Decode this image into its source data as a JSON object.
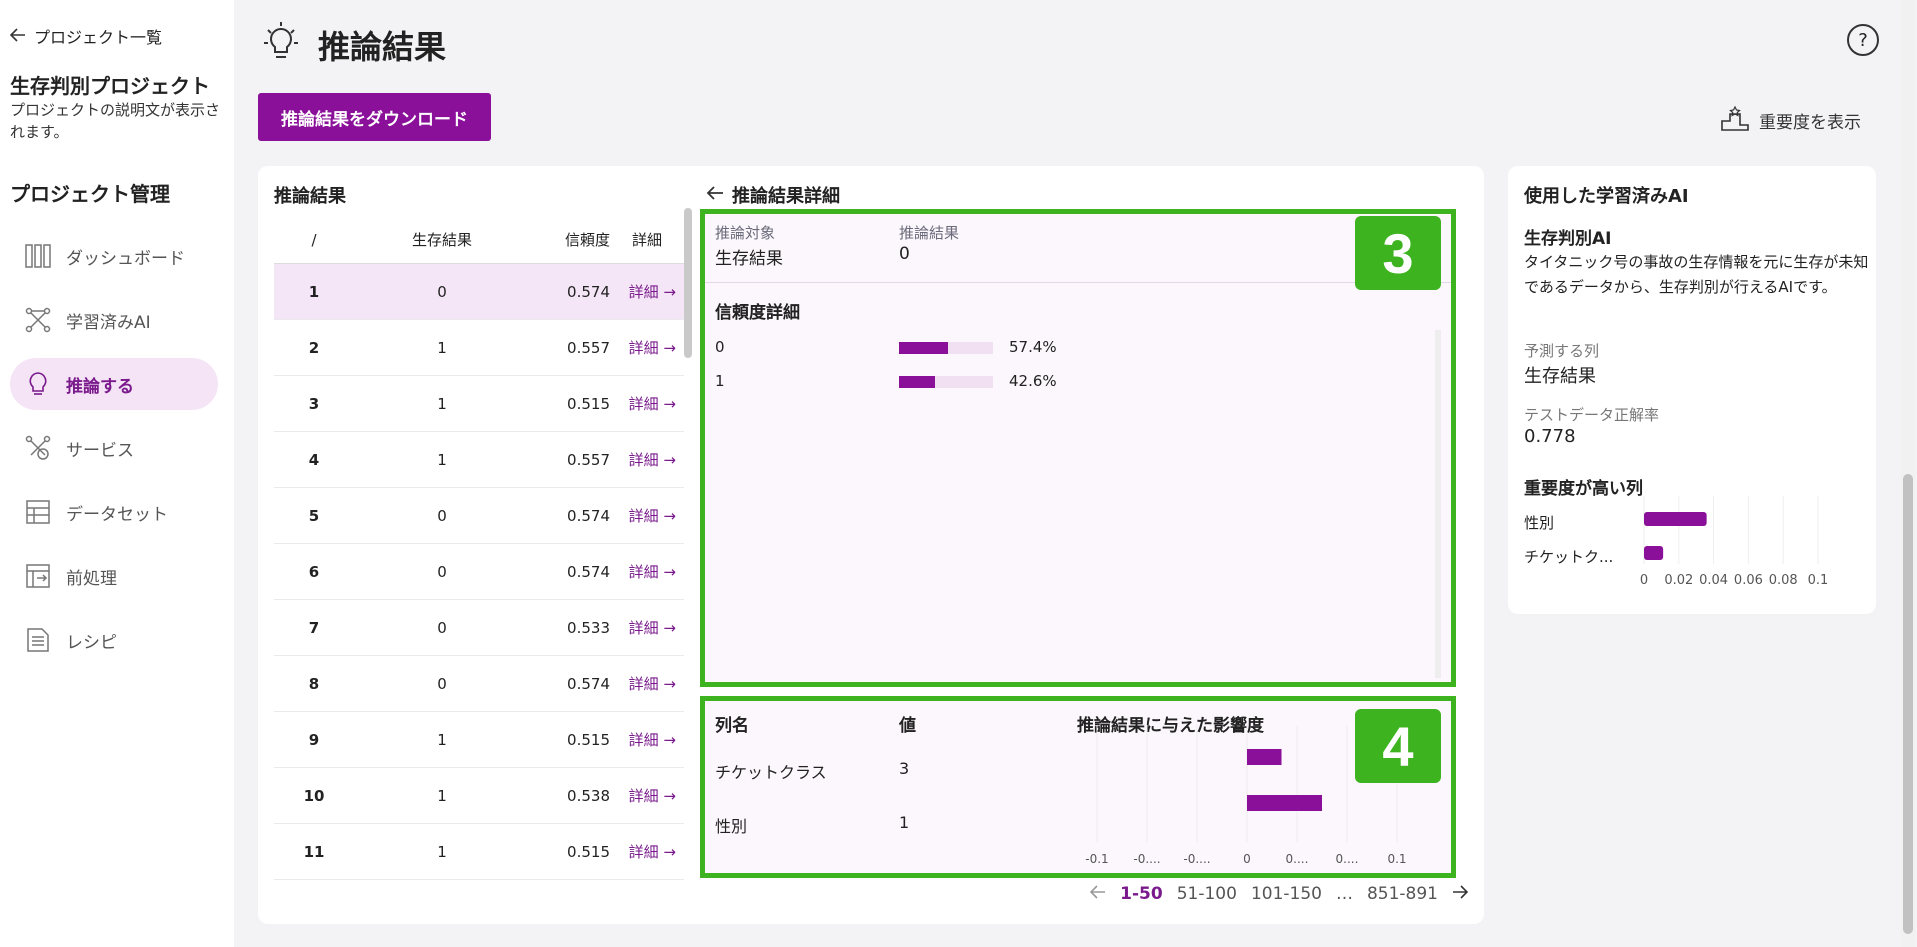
{
  "sidebar": {
    "back_label": "プロジェクト一覧",
    "project_title": "生存判別プロジェクト",
    "project_desc": "プロジェクトの説明文が表示されます。",
    "section_title": "プロジェクト管理",
    "items": [
      {
        "label": "ダッシュボード",
        "icon": "dashboard-icon"
      },
      {
        "label": "学習済みAI",
        "icon": "trained-ai-icon"
      },
      {
        "label": "推論する",
        "icon": "lightbulb-icon"
      },
      {
        "label": "サービス",
        "icon": "service-icon"
      },
      {
        "label": "データセット",
        "icon": "dataset-icon"
      },
      {
        "label": "前処理",
        "icon": "preprocess-icon"
      },
      {
        "label": "レシピ",
        "icon": "recipe-icon"
      }
    ]
  },
  "header": {
    "title": "推論結果",
    "help": "?",
    "download_label": "推論結果をダウンロード",
    "importance_label": "重要度を表示"
  },
  "list": {
    "title": "推論結果",
    "columns": [
      "/",
      "生存結果",
      "信頼度",
      "詳細"
    ],
    "detail_label": "詳細",
    "rows": [
      {
        "idx": "1",
        "result": "0",
        "conf": "0.574"
      },
      {
        "idx": "2",
        "result": "1",
        "conf": "0.557"
      },
      {
        "idx": "3",
        "result": "1",
        "conf": "0.515"
      },
      {
        "idx": "4",
        "result": "1",
        "conf": "0.557"
      },
      {
        "idx": "5",
        "result": "0",
        "conf": "0.574"
      },
      {
        "idx": "6",
        "result": "0",
        "conf": "0.574"
      },
      {
        "idx": "7",
        "result": "0",
        "conf": "0.533"
      },
      {
        "idx": "8",
        "result": "0",
        "conf": "0.574"
      },
      {
        "idx": "9",
        "result": "1",
        "conf": "0.515"
      },
      {
        "idx": "10",
        "result": "1",
        "conf": "0.538"
      },
      {
        "idx": "11",
        "result": "1",
        "conf": "0.515"
      }
    ]
  },
  "detail": {
    "title": "推論結果詳細",
    "target_label": "推論対象",
    "target_value": "生存結果",
    "result_label": "推論結果",
    "result_value": "0",
    "confidence_title": "信頼度詳細",
    "confidence": [
      {
        "label": "0",
        "pct": "57.4%",
        "value": 0.574
      },
      {
        "label": "1",
        "pct": "42.6%",
        "value": 0.426
      }
    ],
    "badge3": "3",
    "badge4": "4",
    "feature_cols": [
      "列名",
      "値",
      "推論結果に与えた影響度"
    ],
    "features": [
      {
        "name": "チケットクラス",
        "value": "3",
        "impact": 0.023
      },
      {
        "name": "性別",
        "value": "1",
        "impact": 0.05
      }
    ],
    "impact_ticks": [
      "-0.1",
      "-0....",
      "-0....",
      "0",
      "0....",
      "0....",
      "0.1"
    ]
  },
  "pager": {
    "items": [
      "1-50",
      "51-100",
      "101-150",
      "…",
      "851-891"
    ]
  },
  "right": {
    "title": "使用した学習済みAI",
    "ai_name": "生存判別AI",
    "ai_desc": "タイタニック号の事故の生存情報を元に生存が未知であるデータから、生存判別が行えるAIです。",
    "predict_label": "予測する列",
    "predict_value": "生存結果",
    "accuracy_label": "テストデータ正解率",
    "accuracy_value": "0.778",
    "importance_title": "重要度が高い列",
    "importance": [
      {
        "name": "性別",
        "value": 0.036
      },
      {
        "name": "チケットク...",
        "value": 0.011
      }
    ],
    "ticks": [
      "0",
      "0.02",
      "0.04",
      "0.06",
      "0.08",
      "0.1"
    ]
  },
  "colors": {
    "accent": "#8a0f99",
    "highlight": "#3db31f"
  }
}
